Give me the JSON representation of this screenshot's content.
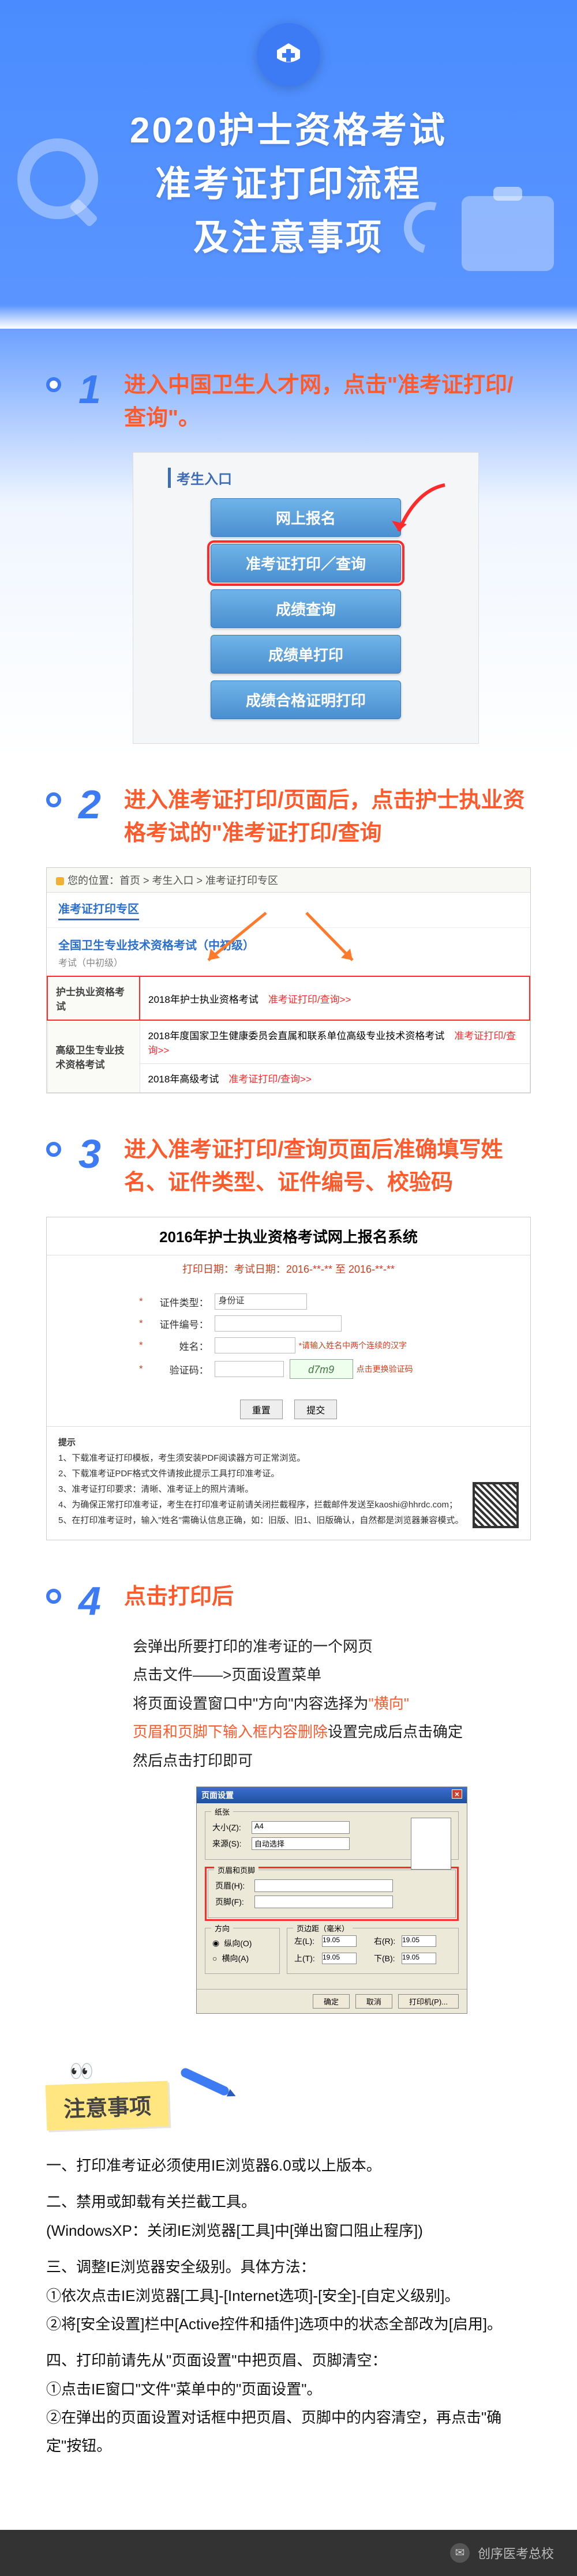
{
  "header": {
    "line1": "2020护士资格考试",
    "line2": "准考证打印流程",
    "line3": "及注意事项"
  },
  "steps": [
    {
      "num": "1",
      "title": "进入中国卫生人才网，点击\"准考证打印/查询\"。",
      "entrance_caption": "考生入口",
      "buttons": [
        "网上报名",
        "准考证打印／查询",
        "成绩查询",
        "成绩单打印",
        "成绩合格证明打印"
      ]
    },
    {
      "num": "2",
      "title": "进入准考证打印/页面后，点击护士执业资格考试的\"准考证打印/查询",
      "breadcrumb": "您的位置：首页 > 考生入口 > 准考证打印专区",
      "tab": "准考证打印专区",
      "cat_title": "全国卫生专业技术资格考试（中初级）",
      "rows": [
        {
          "label": "护士执业资格考试",
          "text": "2018年护士执业资格考试",
          "link": "准考证打印/查询>>",
          "boxed": true
        },
        {
          "label": "高级卫生专业技术资格考试",
          "text": "2018年度国家卫生健康委员会直属和联系单位高级专业技术资格考试",
          "link": "准考证打印/查询>>"
        },
        {
          "label": "",
          "text": "2018年高级考试",
          "link": "准考证打印/查询>>"
        }
      ]
    },
    {
      "num": "3",
      "title": "进入准考证打印/查询页面后准确填写姓名、证件类型、证件编号、校验码",
      "panel_title": "2016年护士执业资格考试网上报名系统",
      "panel_sub": "打印日期：考试日期：2016-**-** 至 2016-**-**",
      "fields": {
        "id_type_label": "证件类型：",
        "id_type_value": "身份证",
        "id_no_label": "证件编号：",
        "name_label": "姓名：",
        "name_hint": "*请输入姓名中两个连续的汉字",
        "captcha_label": "验证码：",
        "captcha_hint": "点击更换验证码",
        "captcha_text": "d7m9"
      },
      "btns": [
        "重置",
        "提交"
      ],
      "notes_label": "提示",
      "notes": [
        "1、下载准考证打印模板，考生须安装PDF阅读器方可正常浏览。",
        "2、下载准考证PDF格式文件请按此提示工具打印准考证。",
        "3、准考证打印要求：清晰、准考证上的照片清晰。",
        "4、为确保正常打印准考证，考生在打印准考证前请关闭拦截程序，拦截邮件发送至kaoshi@hhrdc.com；",
        "5、在打印准考证时，输入\"姓名\"需确认信息正确，如：旧版、旧1、旧版确认，自然都是浏览器兼容模式。"
      ]
    },
    {
      "num": "4",
      "title": "点击打印后",
      "sub_lines": [
        {
          "t": "会弹出所要打印的准考证的一个网页"
        },
        {
          "t": "点击文件——>页面设置菜单"
        },
        {
          "t": "将页面设置窗口中\"方向\"内容选择为",
          "hl": "\"横向\""
        },
        {
          "t": "",
          "hl": "页眉和页脚下输入框内容删除",
          "t2": "设置完成后点击确定"
        },
        {
          "t": "然后点击打印即可"
        }
      ],
      "dlg": {
        "title": "页面设置",
        "paper_legend": "纸张",
        "size_label": "大小(Z):",
        "size_value": "A4",
        "source_label": "来源(S):",
        "source_value": "自动选择",
        "hf_legend": "页眉和页脚",
        "header_label": "页眉(H):",
        "footer_label": "页脚(F):",
        "orient_legend": "方向",
        "orient_portrait": "纵向(O)",
        "orient_landscape": "横向(A)",
        "margin_legend": "页边距（毫米）",
        "margins": {
          "left": "左(L):",
          "right": "右(R):",
          "top": "上(T):",
          "bottom": "下(B):",
          "v": "19.05"
        },
        "ok": "确定",
        "cancel": "取消",
        "printer": "打印机(P)..."
      }
    }
  ],
  "notes_section": {
    "tag": "注意事项",
    "items": [
      "一、打印准考证必须使用IE浏览器6.0或以上版本。",
      "二、禁用或卸载有关拦截工具。\n(WindowsXP：关闭IE浏览器[工具]中[弹出窗口阻止程序])",
      "三、调整IE浏览器安全级别。具体方法：\n①依次点击IE浏览器[工具]-[Internet选项]-[安全]-[自定义级别]。\n②将[安全设置]栏中[Active控件和插件]选项中的状态全部改为[启用]。",
      "四、打印前请先从\"页面设置\"中把页眉、页脚清空：\n①点击IE窗口\"文件\"菜单中的\"页面设置\"。\n②在弹出的页面设置对话框中把页眉、页脚中的内容清空，再点击\"确定\"按钮。"
    ]
  },
  "footer": {
    "text": "创序医考总校"
  }
}
